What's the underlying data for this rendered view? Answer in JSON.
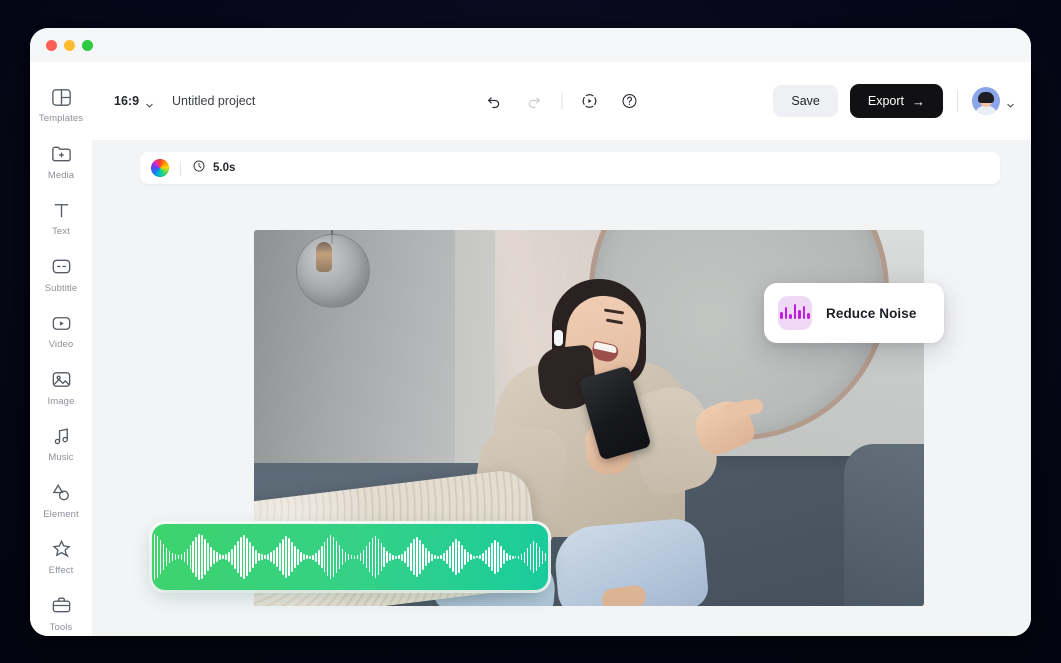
{
  "window": {
    "traffic_lights": [
      "close",
      "minimize",
      "maximize"
    ]
  },
  "sidebar": {
    "items": [
      {
        "label": "Templates",
        "icon": "templates-icon"
      },
      {
        "label": "Media",
        "icon": "media-folder-plus-icon"
      },
      {
        "label": "Text",
        "icon": "text-t-icon"
      },
      {
        "label": "Subtitle",
        "icon": "subtitle-icon"
      },
      {
        "label": "Video",
        "icon": "video-play-icon"
      },
      {
        "label": "Image",
        "icon": "image-icon"
      },
      {
        "label": "Music",
        "icon": "music-note-icon"
      },
      {
        "label": "Element",
        "icon": "element-shapes-icon"
      },
      {
        "label": "Effect",
        "icon": "effect-sparkle-icon"
      },
      {
        "label": "Tools",
        "icon": "tools-briefcase-icon"
      }
    ]
  },
  "header": {
    "aspect_ratio": "16:9",
    "aspect_ratio_caret": "chevron-down-icon",
    "project_name": "Untitled project",
    "undo": {
      "name": "undo-icon",
      "enabled": true
    },
    "redo": {
      "name": "redo-icon",
      "enabled": false
    },
    "preview": {
      "name": "preview-play-icon"
    },
    "help": {
      "name": "help-question-icon"
    },
    "save_label": "Save",
    "export_label": "Export",
    "export_arrow": "→",
    "avatar": "user-avatar",
    "avatar_caret": "chevron-down-icon"
  },
  "properties_bar": {
    "color_wheel": "color-wheel-icon",
    "clock_icon": "clock-icon",
    "duration": "5.0s"
  },
  "canvas": {
    "video_alt": "Woman laughing with phone on couch"
  },
  "reduce_noise_card": {
    "label": "Reduce Noise",
    "icon": "audio-waveform-icon",
    "icon_bg": "#f0d8f7",
    "icon_color": "#c01fe0"
  },
  "audio_clip": {
    "name": "audio-waveform-clip",
    "gradient_start": "#3ed36c",
    "gradient_end": "#19cc9c",
    "waveform": [
      3,
      22,
      46,
      40,
      44,
      36,
      42,
      30,
      38,
      24,
      34,
      20,
      12,
      8,
      6,
      8,
      10,
      12,
      16,
      20,
      24,
      30,
      34,
      28,
      22,
      16,
      12,
      14,
      18,
      24,
      30,
      36,
      42,
      38,
      30,
      22,
      16,
      12,
      8,
      10,
      14,
      18,
      24,
      30,
      36,
      42,
      46,
      40,
      34,
      28,
      20,
      14,
      10,
      8,
      10,
      14,
      20,
      26,
      32,
      38,
      44,
      40,
      34,
      26,
      18,
      12,
      8,
      6,
      8,
      12,
      18,
      26,
      34,
      42,
      46,
      42,
      34,
      26,
      18,
      12,
      8,
      6,
      4,
      6,
      10,
      16,
      24,
      32,
      40,
      46,
      44,
      36,
      28,
      20,
      14,
      10,
      6,
      4,
      6,
      10,
      16,
      24,
      32,
      40,
      44,
      38,
      30,
      22,
      14,
      8,
      6,
      4,
      6,
      10,
      14,
      20,
      28,
      36,
      42,
      38,
      30,
      22,
      16,
      10,
      6,
      4,
      3,
      5,
      9,
      15,
      22,
      30,
      38,
      44,
      40,
      32,
      24,
      16,
      10,
      6,
      4,
      3,
      4,
      8,
      14,
      22,
      30,
      38,
      42,
      36,
      28,
      20,
      12,
      8,
      5,
      3,
      4,
      7,
      12,
      20,
      28,
      36,
      40,
      34,
      26,
      18,
      12,
      7,
      4,
      3,
      4,
      8,
      14,
      22,
      30,
      36,
      32,
      24,
      16,
      10,
      6,
      3,
      2,
      4,
      8,
      14,
      20,
      28,
      34,
      30,
      22,
      14,
      8,
      5,
      3,
      2,
      3,
      6,
      11,
      18,
      26,
      32,
      28,
      20,
      13,
      8,
      4,
      2,
      2,
      4,
      8,
      14,
      20,
      26,
      30,
      24,
      17,
      11,
      6,
      3,
      2,
      3,
      6,
      10,
      16,
      22,
      28,
      24,
      18,
      12,
      7,
      4,
      2,
      2,
      4,
      7,
      12,
      18,
      24,
      20,
      15,
      10,
      5,
      3,
      2,
      2,
      3,
      6,
      10,
      15,
      20,
      17,
      12,
      8,
      5,
      3,
      2,
      2,
      3,
      5,
      9,
      13,
      17,
      14,
      10,
      6,
      4,
      2,
      2,
      2,
      3,
      5,
      8,
      12,
      14,
      11,
      8,
      5,
      3,
      2
    ]
  }
}
